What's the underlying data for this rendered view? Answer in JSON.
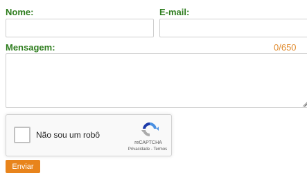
{
  "form": {
    "nome_label": "Nome:",
    "nome_value": "",
    "email_label": "E-mail:",
    "email_value": "",
    "mensagem_label": "Mensagem:",
    "mensagem_value": "",
    "char_counter": "0/650",
    "submit_label": "Enviar"
  },
  "captcha": {
    "checkbox_label": "Não sou um robô",
    "brand": "reCAPTCHA",
    "privacy_link": "Privacidade",
    "separator": " - ",
    "terms_link": "Termos",
    "icon": "recaptcha-logo-icon"
  },
  "colors": {
    "label_green": "#2e7d1e",
    "counter_orange": "#e08a2c",
    "button_orange": "#e8841c"
  }
}
